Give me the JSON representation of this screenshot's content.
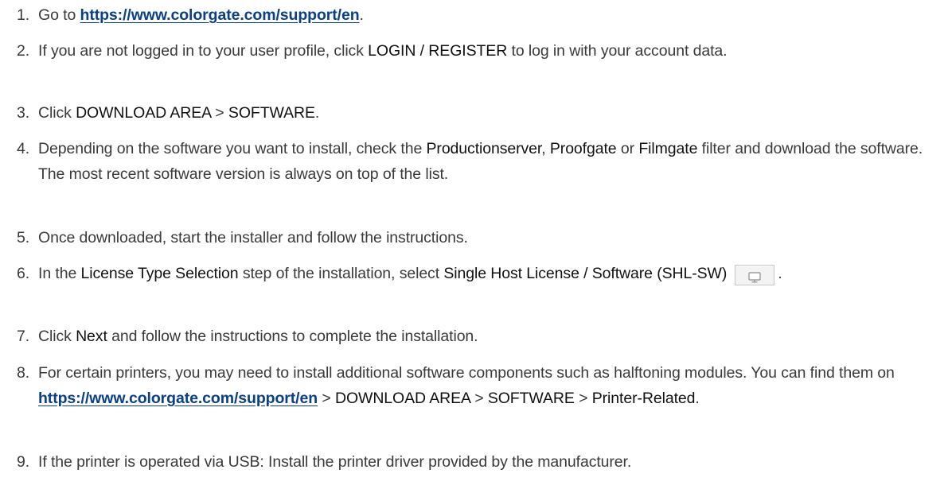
{
  "steps": [
    {
      "num": "1.",
      "pre": "Go to ",
      "link": "https://www.colorgate.com/support/en",
      "post": "."
    },
    {
      "num": "2.",
      "pre": "If you are not logged in to your user profile, click ",
      "ui": "LOGIN / REGISTER",
      "post": " to log in with your account data."
    },
    {
      "num": "3.",
      "pre": "Click ",
      "ui1": "DOWNLOAD AREA",
      "sep": " > ",
      "ui2": "SOFTWARE",
      "post": "."
    },
    {
      "num": "4.",
      "pre": "Depending on the software you want to install, check the ",
      "ui1": "Productionserver",
      "sep1": ", ",
      "ui2": "Proofgate",
      "sep2": " or ",
      "ui3": "Filmgate",
      "post": " filter and download the software. The most recent software version is always on top of the list."
    },
    {
      "num": "5.",
      "text": "Once downloaded, start the installer and follow the instructions."
    },
    {
      "num": "6.",
      "pre": "In the ",
      "ui1": "License Type Selection",
      "mid": " step of the installation, select ",
      "ui2": "Single Host License / Software (SHL-SW)",
      "post": "."
    },
    {
      "num": "7.",
      "pre": "Click ",
      "ui": "Next",
      "post": " and follow the instructions to complete the installation."
    },
    {
      "num": "8.",
      "pre": "For certain printers, you may need to install additional software components such as halftoning modules. You can find them on ",
      "link": "https://www.colorgate.com/support/en",
      "sep1": " > ",
      "ui1": "DOWNLOAD AREA",
      "sep2": " > ",
      "ui2": "SOFTWARE",
      "sep3": " > ",
      "ui3": "Printer-Related",
      "post": "."
    },
    {
      "num": "9.",
      "text": "If the printer is operated via USB: Install the printer driver provided by the manufacturer."
    }
  ],
  "icons": {
    "shl_sw": "monitor-icon"
  },
  "colors": {
    "link": "#0a3f8a",
    "text": "#3a3a3a",
    "ui_term": "#111111"
  }
}
